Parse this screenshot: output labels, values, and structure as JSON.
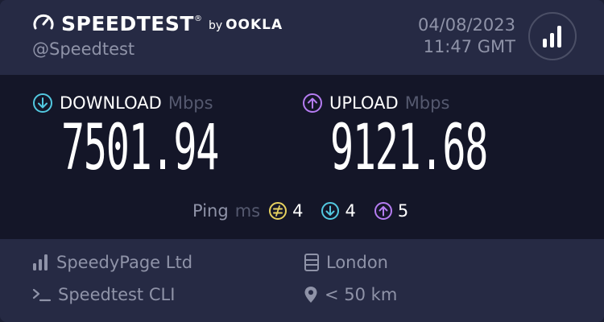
{
  "brand": {
    "name": "SPEEDTEST",
    "by": "by",
    "partner": "OOKLA",
    "trademark": "®"
  },
  "header": {
    "handle": "@Speedtest",
    "date": "04/08/2023",
    "time": "11:47 GMT"
  },
  "download": {
    "label": "DOWNLOAD",
    "unit": "Mbps",
    "value": "7501.94",
    "icon": "download-arrow-icon"
  },
  "upload": {
    "label": "UPLOAD",
    "unit": "Mbps",
    "value": "9121.68",
    "icon": "upload-arrow-icon"
  },
  "ping": {
    "label": "Ping",
    "unit": "ms",
    "idle": "4",
    "download": "4",
    "upload": "5"
  },
  "footer": {
    "isp": "SpeedyPage Ltd",
    "client": "Speedtest CLI",
    "server": "London",
    "distance": "< 50 km"
  },
  "colors": {
    "download": "#52c8e0",
    "upload": "#b57cf2",
    "ping_idle": "#e6d15f",
    "background": "#141628",
    "panel": "#262a44"
  }
}
